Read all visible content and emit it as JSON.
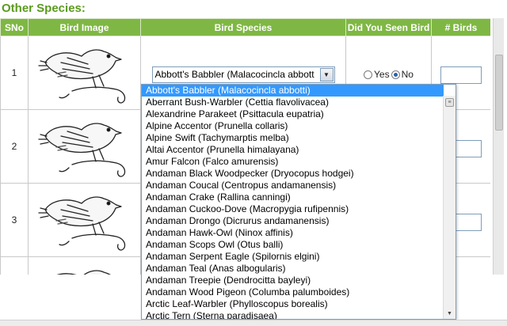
{
  "section": {
    "title": "Other Species:"
  },
  "table": {
    "columns": [
      "SNo",
      "Bird Image",
      "Bird Species",
      "Did You Seen Bird",
      "# Birds"
    ],
    "rows": [
      {
        "sno": "1",
        "species": "Abbott's Babbler (Malacocincla abbott",
        "radio_yes": "Yes",
        "radio_no": "No",
        "seen": "No"
      },
      {
        "sno": "2"
      },
      {
        "sno": "3"
      },
      {
        "sno": ""
      }
    ]
  },
  "dropdown": {
    "selected_index": 0,
    "options": [
      "Abbott's Babbler (Malacocincla abbotti)",
      "Aberrant Bush-Warbler (Cettia flavolivacea)",
      "Alexandrine Parakeet (Psittacula eupatria)",
      "Alpine Accentor (Prunella collaris)",
      "Alpine Swift (Tachymarptis melba)",
      "Altai Accentor (Prunella himalayana)",
      "Amur Falcon (Falco amurensis)",
      "Andaman Black Woodpecker (Dryocopus hodgei)",
      "Andaman Coucal (Centropus andamanensis)",
      "Andaman Crake (Rallina canningi)",
      "Andaman Cuckoo-Dove (Macropygia rufipennis)",
      "Andaman Drongo (Dicrurus andamanensis)",
      "Andaman Hawk-Owl (Ninox affinis)",
      "Andaman Scops Owl (Otus balli)",
      "Andaman Serpent Eagle (Spilornis elgini)",
      "Andaman Teal (Anas albogularis)",
      "Andaman Treepie (Dendrocitta bayleyi)",
      "Andaman Wood Pigeon (Columba palumboides)",
      "Arctic Leaf-Warbler (Phylloscopus borealis)",
      "Arctic Tern (Sterna paradisaea)"
    ]
  },
  "icons": {
    "dropdown_arrow": "chevron-down-icon",
    "bird_image": "bird-sketch-icon",
    "scroll_up": "arrow-up-icon",
    "scroll_down": "arrow-down-icon"
  },
  "colors": {
    "heading": "#5a9b1e",
    "header_bg": "#7fb744",
    "selection": "#3399ff"
  }
}
